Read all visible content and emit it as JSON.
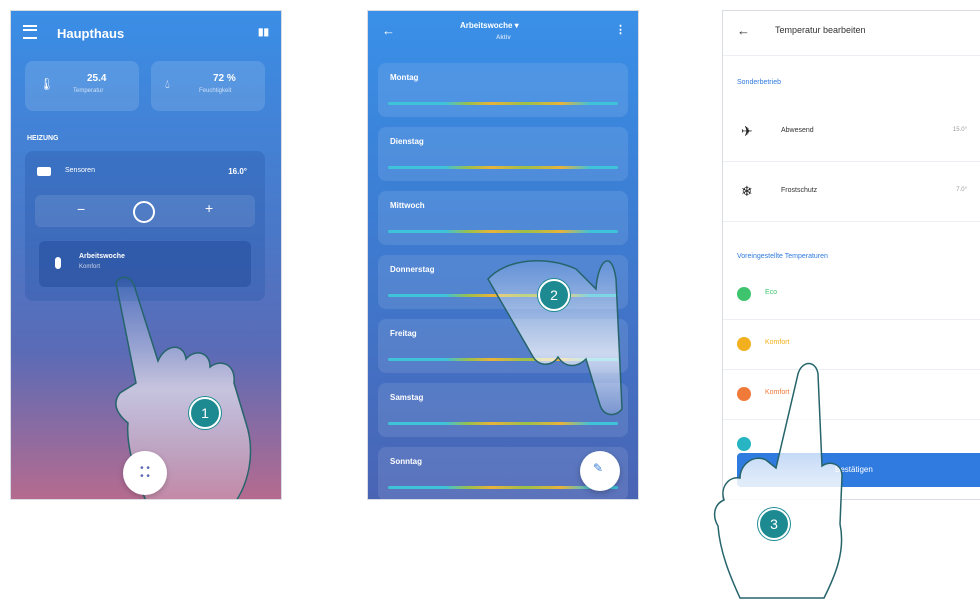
{
  "phone1": {
    "title": "Haupthaus",
    "temp_value": "25.4",
    "temp_label": "Temperatur",
    "humidity_value": "72 %",
    "humidity_label": "Feuchtigkeit",
    "section_label": "HEIZUNG",
    "sensor_label": "Sensoren",
    "sensor_temp": "16.0°",
    "minus": "−",
    "plus": "+",
    "program_title": "Arbeitswoche",
    "program_sub": "Komfort",
    "step": "1"
  },
  "phone2": {
    "title": "Arbeitswoche ▾",
    "subtitle": "Aktiv",
    "days": [
      "Montag",
      "Dienstag",
      "Mittwoch",
      "Donnerstag",
      "Freitag",
      "Samstag",
      "Sonntag"
    ],
    "step": "2"
  },
  "phone3": {
    "title": "Temperatur bearbeiten",
    "section1": "Sonderbetrieb",
    "items": [
      {
        "label": "Abwesend",
        "value": "15.0°"
      },
      {
        "label": "Frostschutz",
        "value": "7.0°"
      }
    ],
    "section2": "Voreingestellte Temperaturen",
    "presets": [
      {
        "label": "Eco",
        "color": "#3ec46d"
      },
      {
        "label": "Komfort",
        "color": "#f2b01e"
      },
      {
        "label": "Komfort",
        "color": "#ef7a3a"
      },
      {
        "label": "",
        "color": "#27b5c4"
      }
    ],
    "confirm": "Bestätigen",
    "step": "3"
  },
  "colors": {
    "accent": "#2f7be0",
    "badge": "#1d8a92"
  }
}
